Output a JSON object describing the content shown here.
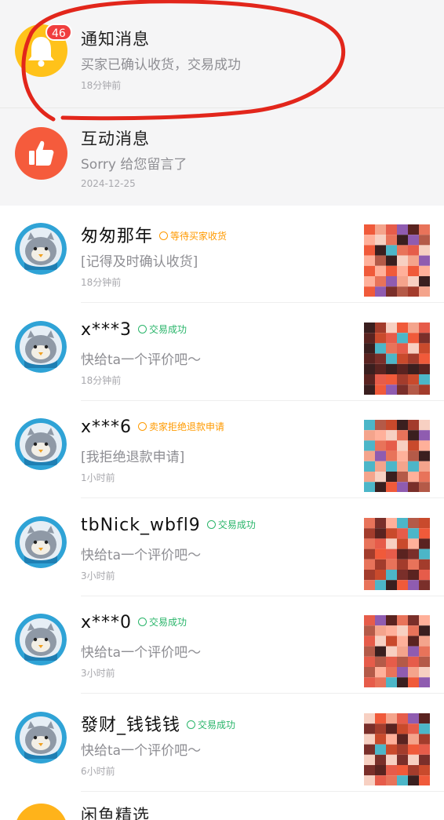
{
  "notification": {
    "title": "通知消息",
    "badge": "46",
    "subtitle": "买家已确认收货，交易成功",
    "time": "18分钟前",
    "icon": "bell-icon",
    "color": "#ffc21a"
  },
  "interaction": {
    "title": "互动消息",
    "subtitle": "Sorry 给您留言了",
    "time": "2024-12-25",
    "icon": "thumbs-up-icon",
    "color": "#f55b3c"
  },
  "messages": [
    {
      "name": "匆匆那年",
      "status": "等待买家收货",
      "status_type": "wait",
      "preview": "[记得及时确认收货]",
      "time": "18分钟前"
    },
    {
      "name": "x***3",
      "status": "交易成功",
      "status_type": "ok",
      "preview": "快给ta一个评价吧～",
      "time": "18分钟前"
    },
    {
      "name": "x***6",
      "status": "卖家拒绝退款申请",
      "status_type": "wait",
      "preview": "[我拒绝退款申请]",
      "time": "1小时前"
    },
    {
      "name": "tbNick_wbfl9",
      "status": "交易成功",
      "status_type": "ok",
      "preview": "快给ta一个评价吧～",
      "time": "3小时前"
    },
    {
      "name": "x***0",
      "status": "交易成功",
      "status_type": "ok",
      "preview": "快给ta一个评价吧～",
      "time": "3小时前"
    },
    {
      "name": "發财_钱钱钱",
      "status": "交易成功",
      "status_type": "ok",
      "preview": "快给ta一个评价吧～",
      "time": "6小时前"
    }
  ],
  "bottom": {
    "title": "闲鱼精选"
  },
  "colors": {
    "success": "#29b56a",
    "waiting": "#ff9a00",
    "badge": "#f03e3e",
    "annotation": "#e2261b"
  }
}
